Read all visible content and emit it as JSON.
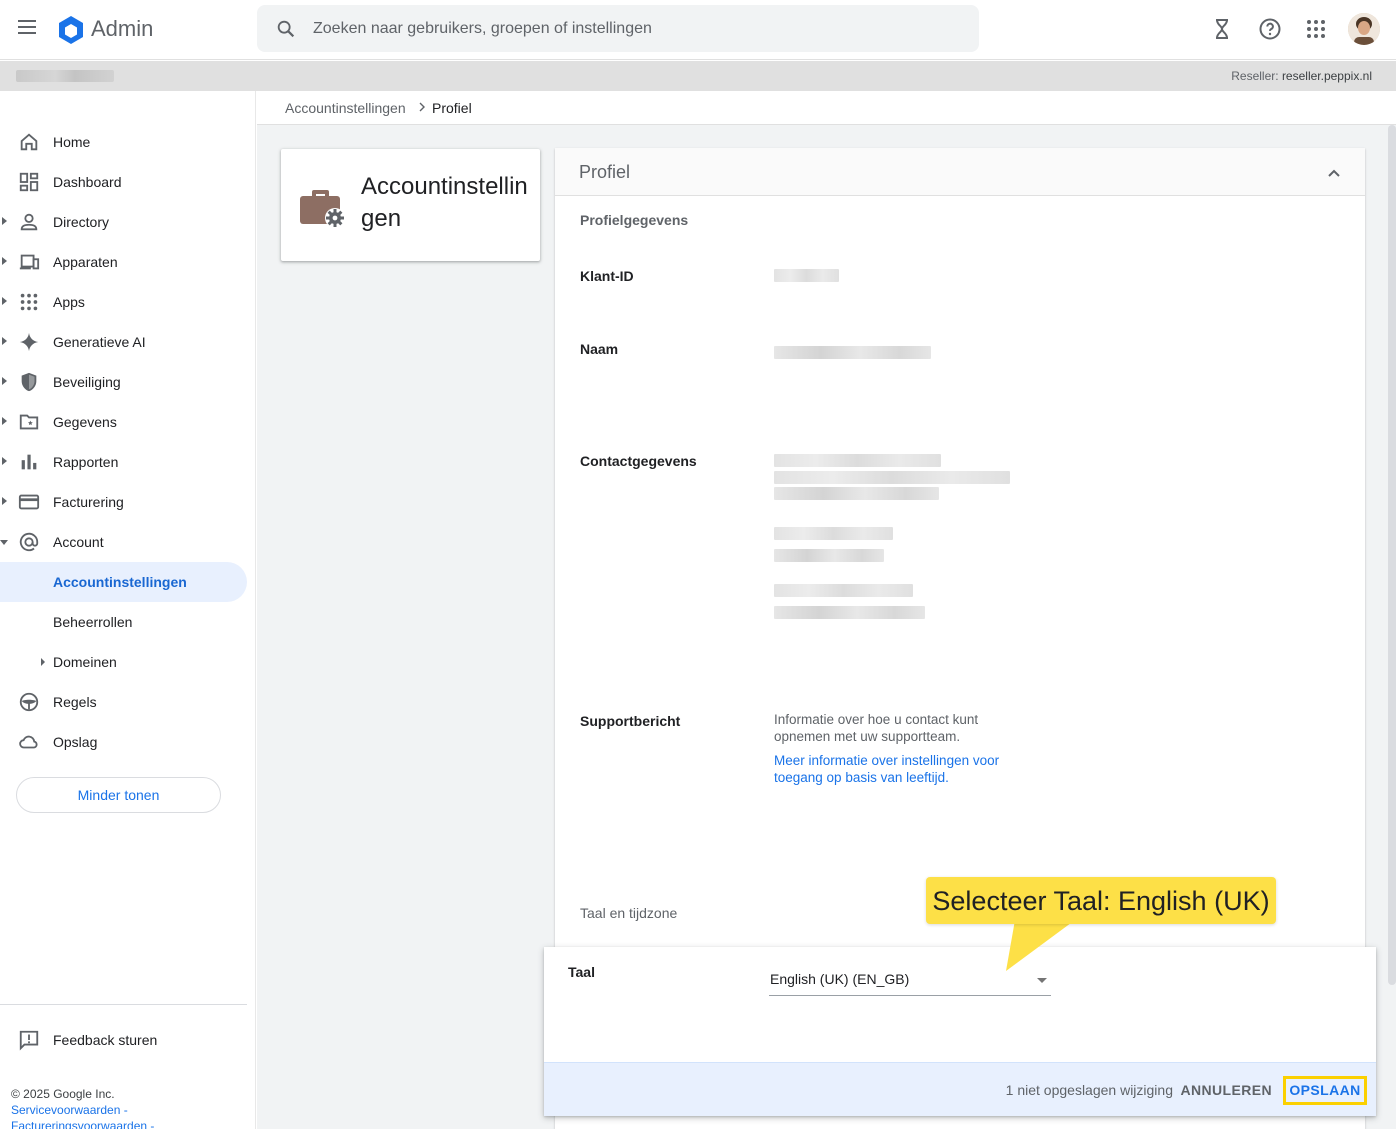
{
  "header": {
    "brand": "Admin",
    "search_placeholder": "Zoeken naar gebruikers, groepen of instellingen"
  },
  "reseller": {
    "label": "Reseller:",
    "value": "reseller.peppix.nl"
  },
  "sidebar": {
    "items": [
      {
        "label": "Home",
        "icon": "home-icon"
      },
      {
        "label": "Dashboard",
        "icon": "dashboard-icon"
      },
      {
        "label": "Directory",
        "icon": "person-icon"
      },
      {
        "label": "Apparaten",
        "icon": "devices-icon"
      },
      {
        "label": "Apps",
        "icon": "apps-grid-icon"
      },
      {
        "label": "Generatieve AI",
        "icon": "sparkle-icon"
      },
      {
        "label": "Beveiliging",
        "icon": "shield-icon"
      },
      {
        "label": "Gegevens",
        "icon": "folder-star-icon"
      },
      {
        "label": "Rapporten",
        "icon": "bar-chart-icon"
      },
      {
        "label": "Facturering",
        "icon": "credit-card-icon"
      },
      {
        "label": "Account",
        "icon": "at-sign-icon"
      },
      {
        "label": "Accountinstellingen"
      },
      {
        "label": "Beheerrollen"
      },
      {
        "label": "Domeinen"
      },
      {
        "label": "Regels",
        "icon": "steering-icon"
      },
      {
        "label": "Opslag",
        "icon": "cloud-icon"
      }
    ],
    "less_button": "Minder tonen",
    "feedback": "Feedback sturen",
    "footer": {
      "copyright": "© 2025 Google Inc.",
      "terms": "Servicevoorwaarden -",
      "billing_terms": "Factureringsvoorwaarden -"
    }
  },
  "breadcrumb": {
    "parent": "Accountinstellingen",
    "current": "Profiel"
  },
  "account_card": {
    "title": "Accountinstellingen",
    "icon": "briefcase-gear-icon",
    "icon_color": "#8d6e63"
  },
  "profile": {
    "title": "Profiel",
    "section_details": "Profielgegevens",
    "customer_id_label": "Klant-ID",
    "name_label": "Naam",
    "contact_label": "Contactgegevens",
    "support_label": "Supportbericht",
    "support_text": "Informatie over hoe u contact kunt opnemen met uw supportteam.",
    "support_link": "Meer informatie over instellingen voor toegang op basis van leeftijd.",
    "section_language": "Taal en tijdzone"
  },
  "language": {
    "label": "Taal",
    "value": "English (UK) (EN_GB)",
    "unsaved": "1 niet opgeslagen wijziging",
    "cancel": "ANNULEREN",
    "save": "OPSLAAN"
  },
  "callout": {
    "text": "Selecteer Taal: English (UK)",
    "color": "#fde047"
  },
  "colors": {
    "accent": "#1a73e8",
    "active_bg": "#e8f0fe",
    "highlight": "#fbd000"
  }
}
